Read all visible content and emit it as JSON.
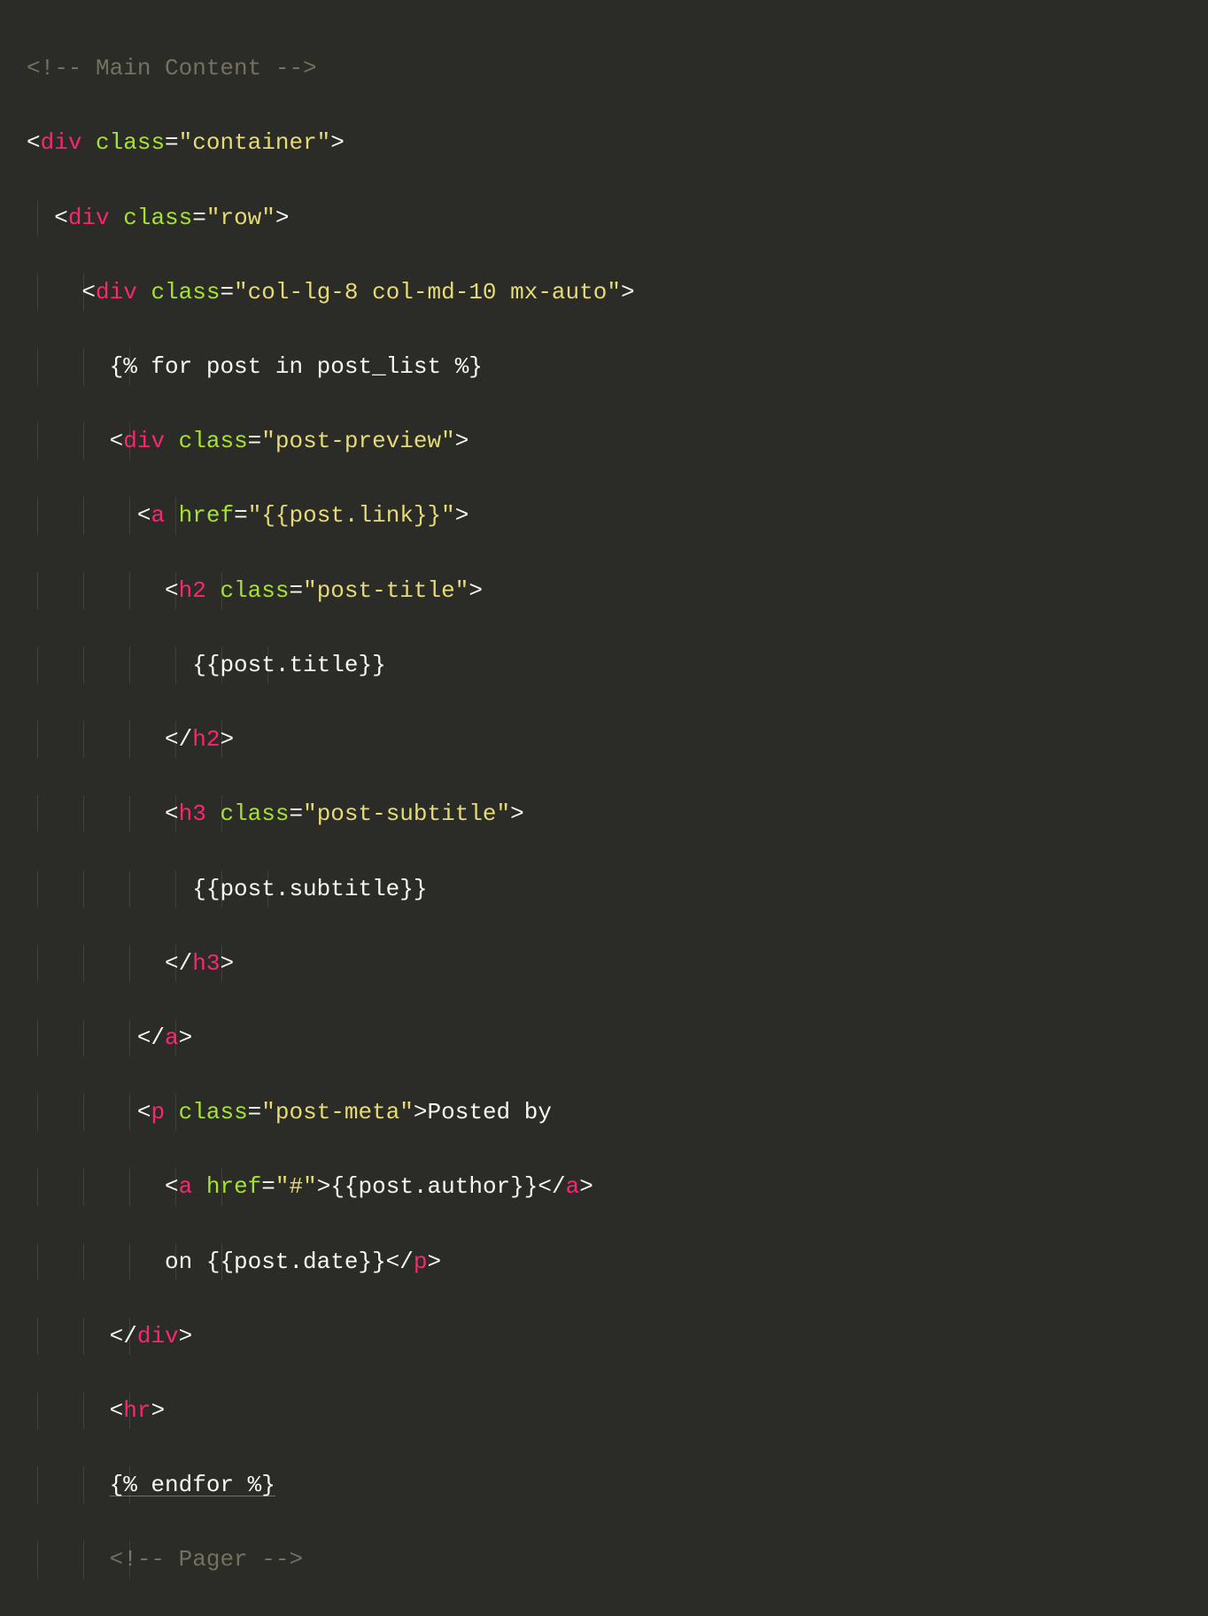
{
  "code": {
    "l1": {
      "comment": "<!-- Main Content -->"
    },
    "l2": {
      "open": "<",
      "tag": "div",
      "sp": " ",
      "attr": "class",
      "eq": "=",
      "str": "\"container\"",
      "close": ">"
    },
    "l3": {
      "open": "<",
      "tag": "div",
      "sp": " ",
      "attr": "class",
      "eq": "=",
      "str": "\"row\"",
      "close": ">"
    },
    "l4": {
      "open": "<",
      "tag": "div",
      "sp": " ",
      "attr": "class",
      "eq": "=",
      "str": "\"col-lg-8 col-md-10 mx-auto\"",
      "close": ">"
    },
    "l5": {
      "txt": "{% for post in post_list %}"
    },
    "l6": {
      "open": "<",
      "tag": "div",
      "sp": " ",
      "attr": "class",
      "eq": "=",
      "str": "\"post-preview\"",
      "close": ">"
    },
    "l7": {
      "open": "<",
      "tag": "a",
      "sp": " ",
      "attr": "href",
      "eq": "=",
      "str": "\"{{post.link}}\"",
      "close": ">"
    },
    "l8": {
      "open": "<",
      "tag": "h2",
      "sp": " ",
      "attr": "class",
      "eq": "=",
      "str": "\"post-title\"",
      "close": ">"
    },
    "l9": {
      "txt": "{{post.title}}"
    },
    "l10": {
      "open": "</",
      "tag": "h2",
      "close": ">"
    },
    "l11": {
      "open": "<",
      "tag": "h3",
      "sp": " ",
      "attr": "class",
      "eq": "=",
      "str": "\"post-subtitle\"",
      "close": ">"
    },
    "l12": {
      "txt": "{{post.subtitle}}"
    },
    "l13": {
      "open": "</",
      "tag": "h3",
      "close": ">"
    },
    "l14": {
      "open": "</",
      "tag": "a",
      "close": ">"
    },
    "l15": {
      "open": "<",
      "tag": "p",
      "sp": " ",
      "attr": "class",
      "eq": "=",
      "str": "\"post-meta\"",
      "close": ">",
      "txt": "Posted by"
    },
    "l16": {
      "open": "<",
      "tag": "a",
      "sp": " ",
      "attr": "href",
      "eq": "=",
      "str": "\"#\"",
      "close": ">",
      "txt": "{{post.author}}",
      "open2": "</",
      "tag2": "a",
      "close2": ">"
    },
    "l17": {
      "txt": "on {{post.date}}",
      "open": "</",
      "tag": "p",
      "close": ">"
    },
    "l18": {
      "open": "</",
      "tag": "div",
      "close": ">"
    },
    "l19": {
      "open": "<",
      "tag": "hr",
      "close": ">"
    },
    "l20": {
      "txt": "{% endfor %}"
    },
    "l21": {
      "comment": "<!-- Pager -->"
    }
  }
}
